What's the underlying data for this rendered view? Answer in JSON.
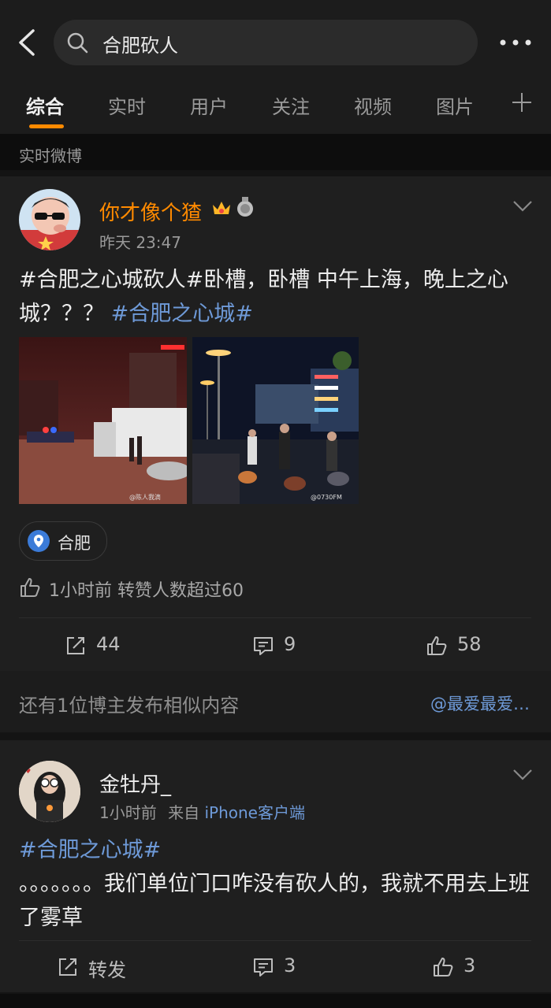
{
  "search": {
    "query": "合肥砍人"
  },
  "tabs": [
    "综合",
    "实时",
    "用户",
    "关注",
    "视频",
    "图片"
  ],
  "section_header": "实时微博",
  "posts": [
    {
      "author": "你才像个猹",
      "time": "昨天 23:47",
      "text_parts": [
        "#合肥之心城砍人#卧槽，卧槽 中午上海，晚上之心城？？？",
        "#合肥之心城#"
      ],
      "image_watermarks": [
        "@陈人我滴",
        "@0730FM"
      ],
      "location": "合肥",
      "like_info": "1小时前 转赞人数超过60",
      "reposts": "44",
      "comments": "9",
      "likes": "58",
      "author_color": "#ff8a00"
    },
    {
      "author": "金牡丹_",
      "time": "1小时前",
      "source_prefix": "来自",
      "source": "iPhone客户端",
      "tag": "#合肥之心城#",
      "text": "。。。。。。。我们单位门口咋没有砍人的，我就不用去上班了雾草",
      "reposts": "转发",
      "comments": "3",
      "likes": "3"
    }
  ],
  "similar": {
    "text": "还有1位博主发布相似内容",
    "link": "@最爱最爱…"
  },
  "colors": {
    "accent": "#ff8a00",
    "link": "#6e9ad8",
    "background": "#141414",
    "card": "#1f1f1f"
  }
}
